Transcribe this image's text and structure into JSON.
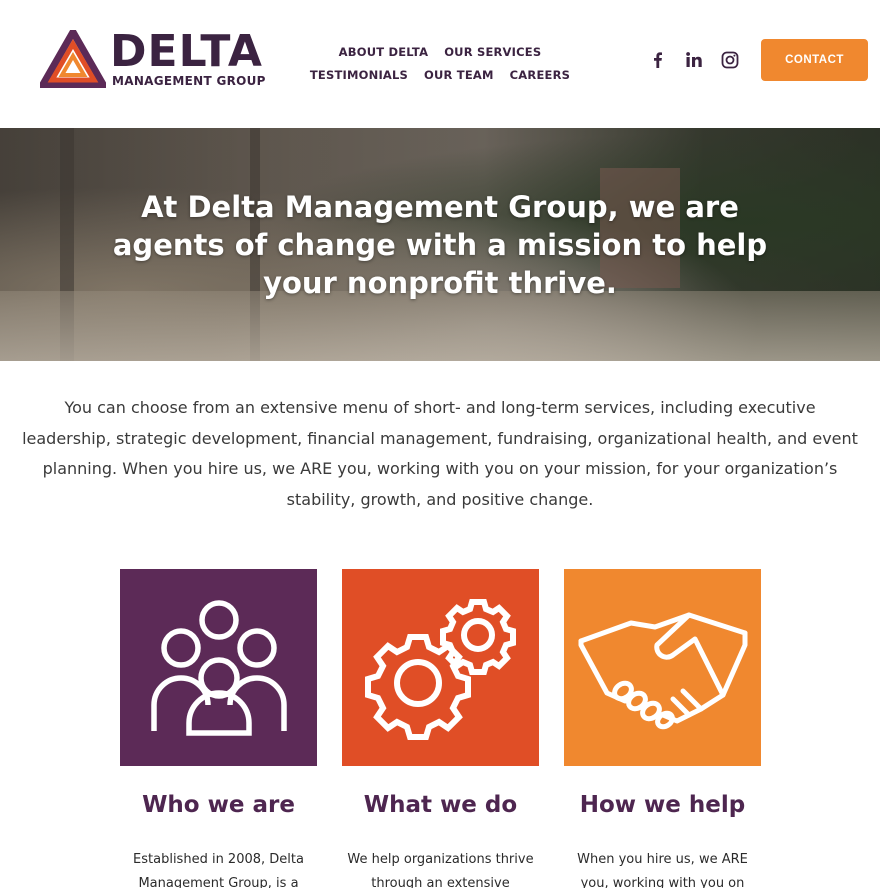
{
  "brand": {
    "name": "DELTA",
    "subtitle": "MANAGEMENT GROUP",
    "colors": {
      "purple": "#5c2a57",
      "orange_red": "#e04e26",
      "orange": "#f0882f",
      "text_dark": "#3b2341"
    }
  },
  "nav": {
    "row1": [
      "ABOUT DELTA",
      "OUR SERVICES"
    ],
    "row2": [
      "TESTIMONIALS",
      "OUR TEAM",
      "CAREERS"
    ]
  },
  "social": {
    "icons": [
      "facebook-icon",
      "linkedin-icon",
      "instagram-icon"
    ]
  },
  "contact_label": "CONTACT",
  "hero": {
    "heading": "At Delta Management Group, we are agents of change with a mission to help your nonprofit thrive."
  },
  "intro": "You can choose from an extensive menu of short- and long-term services, including executive leadership, strategic development, financial management, fundraising, organizational health, and event planning. When you hire us, we ARE you, working with you on your mission, for your organization’s stability, growth, and positive change.",
  "cards": [
    {
      "title": "Who we are",
      "text": "Established in 2008, Delta Management Group, is a",
      "icon": "people-group-icon"
    },
    {
      "title": "What we do",
      "text": "We help organizations thrive through an extensive",
      "icon": "gears-icon"
    },
    {
      "title": "How we help",
      "text": "When you hire us, we ARE you, working with you on",
      "icon": "handshake-icon"
    }
  ]
}
